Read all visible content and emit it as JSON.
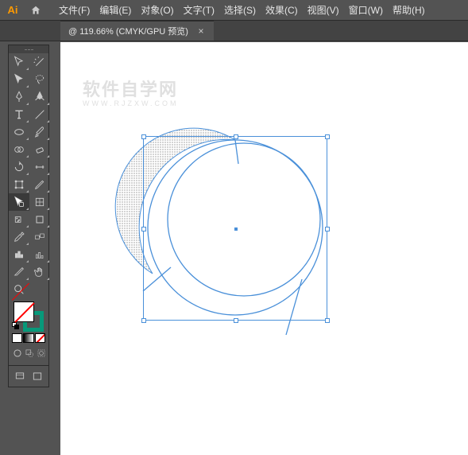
{
  "app": {
    "name": "Ai"
  },
  "menu": {
    "items": [
      {
        "label": "文件(F)"
      },
      {
        "label": "编辑(E)"
      },
      {
        "label": "对象(O)"
      },
      {
        "label": "文字(T)"
      },
      {
        "label": "选择(S)"
      },
      {
        "label": "效果(C)"
      },
      {
        "label": "视图(V)"
      },
      {
        "label": "窗口(W)"
      },
      {
        "label": "帮助(H)"
      }
    ]
  },
  "tab": {
    "label": "@ 119.66% (CMYK/GPU 预览)",
    "close": "×"
  },
  "watermark": {
    "line1": "软件自学网",
    "line2": "WWW.RJZXW.COM"
  },
  "colors": {
    "select": "#4a90d9",
    "stroke_active": "#08997a"
  },
  "tools": {
    "left": [
      "selection-tool",
      "direct-selection-tool",
      "pen-tool",
      "type-tool",
      "ellipse-tool",
      "shape-builder-tool",
      "rotate-tool",
      "lasso-tool",
      "symbol-sprayer-tool",
      "eyedropper-tool",
      "bar-tool",
      "hand-tool"
    ],
    "right": [
      "magic-wand-tool",
      "anchor-point-tool",
      "curvature-tool",
      "line-tool",
      "brush-tool",
      "eraser-tool",
      "width-tool",
      "pencil-tool",
      "perspective-tool",
      "blend-tool",
      "column-graph-tool",
      "slice-tool",
      "zoom-tool"
    ]
  }
}
